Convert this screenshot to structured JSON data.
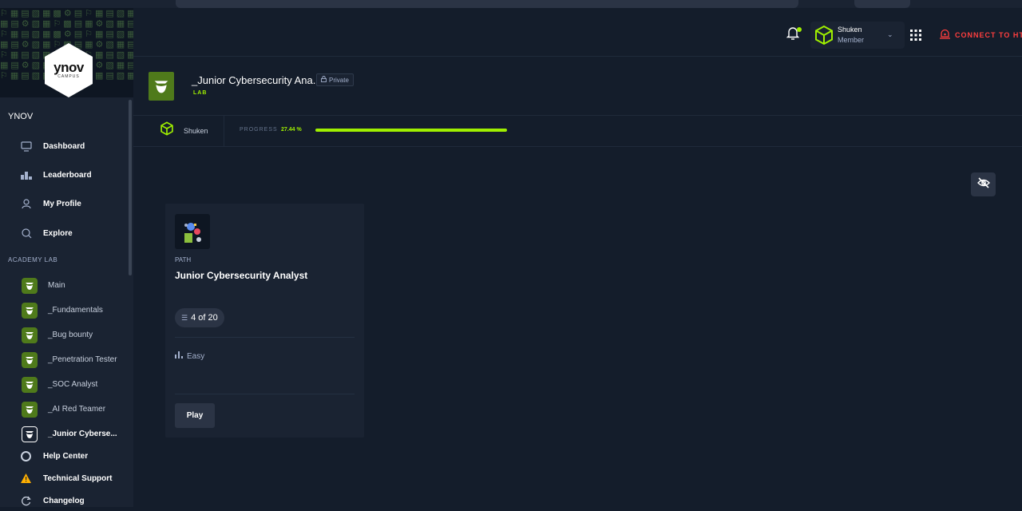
{
  "sidebar": {
    "org_name": "YNOV",
    "logo": {
      "brand": "ynov",
      "sub": "CAMPUS"
    },
    "nav": [
      {
        "label": "Dashboard",
        "icon": "monitor-icon"
      },
      {
        "label": "Leaderboard",
        "icon": "podium-icon"
      },
      {
        "label": "My Profile",
        "icon": "user-icon"
      },
      {
        "label": "Explore",
        "icon": "explore-icon"
      }
    ],
    "section_label": "ACADEMY LAB",
    "labs": [
      {
        "label": "Main"
      },
      {
        "label": "_Fundamentals"
      },
      {
        "label": "_Bug bounty"
      },
      {
        "label": "_Penetration Tester"
      },
      {
        "label": "_SOC Analyst"
      },
      {
        "label": "_AI Red Teamer"
      },
      {
        "label": "_Junior Cyberse...",
        "active": true
      }
    ],
    "bottom": [
      {
        "label": "Help Center",
        "icon": "lifebuoy-icon"
      },
      {
        "label": "Technical Support",
        "icon": "warning-icon"
      },
      {
        "label": "Changelog",
        "icon": "refresh-icon"
      }
    ]
  },
  "topbar": {
    "user_name": "Shuken",
    "user_role": "Member",
    "connect_label": "CONNECT TO HTB"
  },
  "header": {
    "title": "_Junior Cybersecurity Ana...",
    "private_label": "Private",
    "tag": "LAB"
  },
  "progress": {
    "user": "Shuken",
    "label": "PROGRESS",
    "value_text": "27.44 %",
    "fraction": 0.2744
  },
  "card": {
    "kind": "PATH",
    "title": "Junior Cybersecurity Analyst",
    "count": "4 of 20",
    "difficulty": "Easy",
    "play_label": "Play"
  },
  "colors": {
    "accent": "#9fef00",
    "badge": "#4f7a1b",
    "danger": "#ff3e3e",
    "bg": "#141d2b",
    "panel": "#1a2332"
  }
}
